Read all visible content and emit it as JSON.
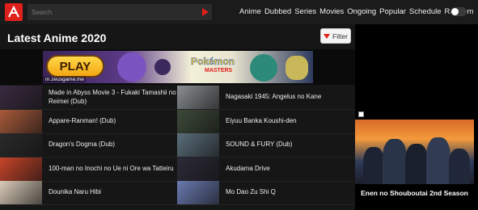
{
  "header": {
    "search_placeholder": "Search",
    "nav": [
      "Anime",
      "Dubbed",
      "Series",
      "Movies",
      "Ongoing",
      "Popular",
      "Schedule",
      "Random"
    ]
  },
  "main": {
    "title": "Latest Anime 2020",
    "filter_label": "Filter"
  },
  "ad": {
    "play_label": "PLAY",
    "logo_text": "Pokémon",
    "logo_sub": "MASTERS",
    "domain": "m.zeusgame.me"
  },
  "anime_list": [
    {
      "title": "Made in Abyss Movie 3 - Fukaki Tamashii no Reimei (Dub)",
      "color": "#3a2a40"
    },
    {
      "title": "Nagasaki 1945: Angelus no Kane",
      "color": "#8a8f92"
    },
    {
      "title": "Appare-Ranman! (Dub)",
      "color": "#a85a3a"
    },
    {
      "title": "Eiyuu Banka Koushi-den",
      "color": "#3d4a3a"
    },
    {
      "title": "Dragon's Dogma (Dub)",
      "color": "#2a2a2a"
    },
    {
      "title": "SOUND & FURY (Dub)",
      "color": "#5a6e7a"
    },
    {
      "title": "100-man no Inochi no Ue ni Ore wa Tatteiru",
      "color": "#c8442a"
    },
    {
      "title": "Akudama Drive",
      "color": "#2d2a38"
    },
    {
      "title": "Dounika Naru Hibi",
      "color": "#d9cbb8"
    },
    {
      "title": "Mo Dao Zu Shi Q",
      "color": "#6a7ab0"
    }
  ],
  "sidebar": {
    "featured_title": "Enen no Shouboutai 2nd Season"
  },
  "colors": {
    "accent": "#e0201c",
    "background": "#000000",
    "panel": "#161616"
  }
}
